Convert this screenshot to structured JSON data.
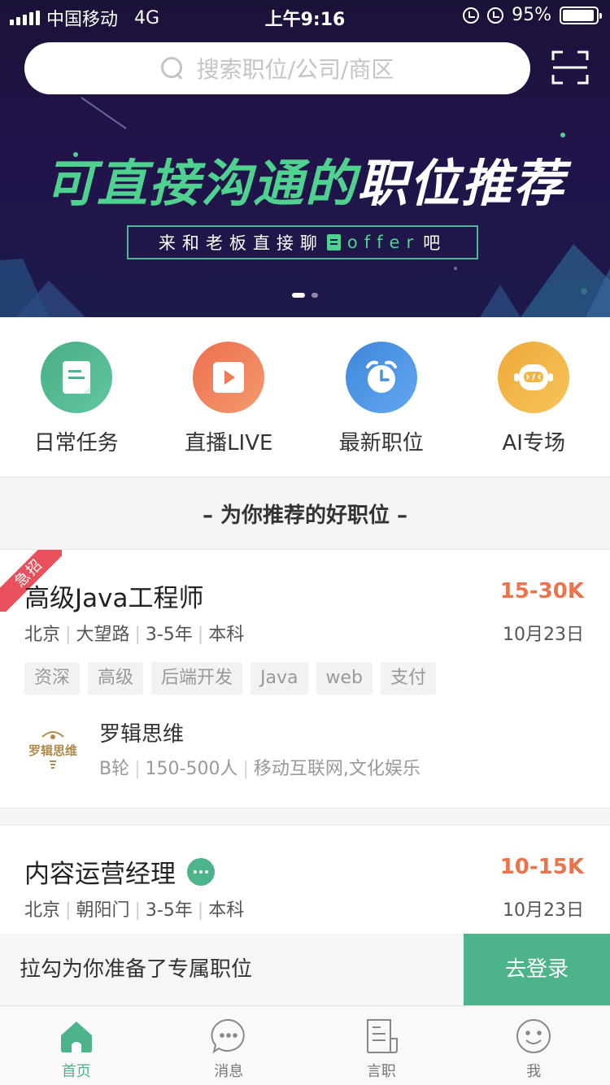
{
  "status_bar": {
    "carrier": "中国移动",
    "network": "4G",
    "time": "上午9:16",
    "battery": "95%",
    "battery_level": 0.95
  },
  "search": {
    "placeholder": "搜索职位/公司/商区",
    "scan_icon": "scan-icon"
  },
  "banner": {
    "title_green": "可直接沟通的",
    "title_white": "职位推荐",
    "subtitle_pre": "来和老板直接聊",
    "subtitle_accent": "offer",
    "subtitle_post": "吧",
    "slide_count": 2,
    "active_slide": 1
  },
  "quick_entries": [
    {
      "label": "日常任务",
      "icon": "task-icon",
      "color": "#4db38a"
    },
    {
      "label": "直播LIVE",
      "icon": "play-icon",
      "color": "#ef7a56"
    },
    {
      "label": "最新职位",
      "icon": "clock-icon",
      "color": "#4a8fe0"
    },
    {
      "label": "AI专场",
      "icon": "robot-icon",
      "color": "#f2b442"
    }
  ],
  "section_title": "– 为你推荐的好职位 –",
  "jobs": [
    {
      "badge": "急招",
      "title": "高级Java工程师",
      "salary": "15-30K",
      "city": "北京",
      "area": "大望路",
      "experience": "3-5年",
      "education": "本科",
      "date": "10月23日",
      "tags": [
        "资深",
        "高级",
        "后端开发",
        "Java",
        "web",
        "支付"
      ],
      "company": {
        "logo_text": "罗辑思维",
        "name": "罗辑思维",
        "stage": "B轮",
        "size": "150-500人",
        "industry": "移动互联网,文化娱乐"
      }
    },
    {
      "title": "内容运营经理",
      "salary": "10-15K",
      "city": "北京",
      "area": "朝阳门",
      "experience": "3-5年",
      "education": "本科",
      "date": "10月23日"
    }
  ],
  "login_bar": {
    "text": "拉勾为你准备了专属职位",
    "button": "去登录"
  },
  "tabs": [
    {
      "label": "首页",
      "icon": "home-icon",
      "active": true
    },
    {
      "label": "消息",
      "icon": "message-icon",
      "active": false
    },
    {
      "label": "言职",
      "icon": "news-icon",
      "active": false
    },
    {
      "label": "我",
      "icon": "profile-icon",
      "active": false
    }
  ],
  "colors": {
    "brand_green": "#4db38a",
    "salary_orange": "#e9754f",
    "urgent_red": "#e8505b"
  }
}
